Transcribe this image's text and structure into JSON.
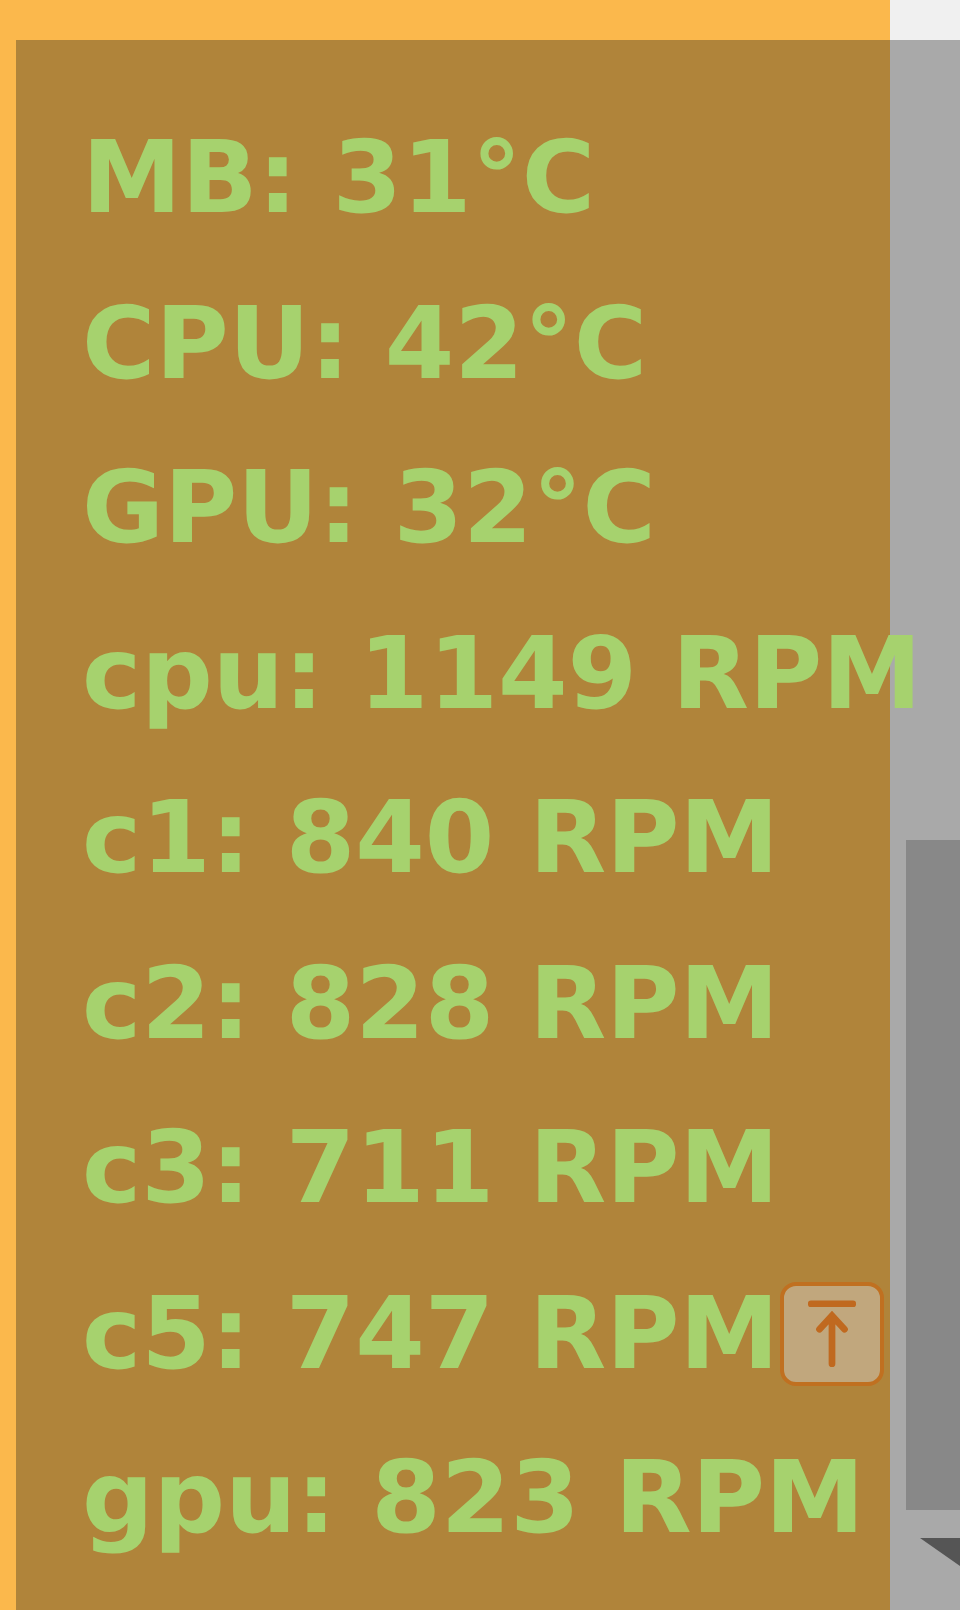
{
  "readings": [
    "MB: 31°C",
    "CPU: 42°C",
    "GPU: 32°C",
    "cpu: 1149 RPM",
    "c1: 840 RPM",
    "c2: 828 RPM",
    "c3: 711 RPM",
    "c5: 747 RPM",
    "gpu: 823 RPM"
  ]
}
